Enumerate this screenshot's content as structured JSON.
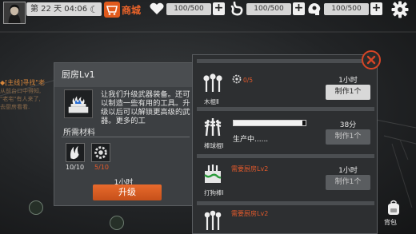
{
  "topbar": {
    "day_label": "第 22 天",
    "time": "04:06",
    "shop_label": "商城",
    "stats": [
      {
        "icon": "heart-icon",
        "value": "100/500"
      },
      {
        "icon": "stomach-icon",
        "value": "100/500"
      },
      {
        "icon": "brain-icon",
        "value": "100/500"
      }
    ],
    "plus": "+"
  },
  "side": {
    "line1": "◆[主线]寻找\"老",
    "line2": "从前台口中得知,",
    "line3": "\"老宅\"有人来了,",
    "line4": "去厨房看看."
  },
  "kitchen": {
    "title": "厨房Lv1",
    "description": "让我们升级武器装备。还可以制造一些有用的工具。升级以后可以解锁更高级的武器。更多的工",
    "requirements_title": "所需材料",
    "requirements": [
      {
        "icon": "claw-icon",
        "count": "10/10",
        "sufficient": true
      },
      {
        "icon": "gear-part-icon",
        "count": "5/10",
        "sufficient": false
      }
    ],
    "time": "1小时",
    "upgrade_label": "升级"
  },
  "recipes": [
    {
      "name": "木棍Ⅱ",
      "material_count": "0/5",
      "time": "1小时",
      "button": "制作1个",
      "enabled": true
    },
    {
      "name": "棒球棍Ⅰ",
      "status": "生产中......",
      "time": "38分",
      "progress": 0.95,
      "button": "制作1个",
      "enabled": false
    },
    {
      "name": "打狗棒Ⅰ",
      "warning": "需要厨房Lv2",
      "time": "1小时",
      "button": "制作1个",
      "enabled": false
    },
    {
      "warning": "需要厨房Lv2"
    }
  ],
  "bottom": {
    "backpack_label": "背包"
  },
  "colors": {
    "accent": "#e86a2c",
    "warning": "#e2592b",
    "panel": "#3c3f42"
  }
}
